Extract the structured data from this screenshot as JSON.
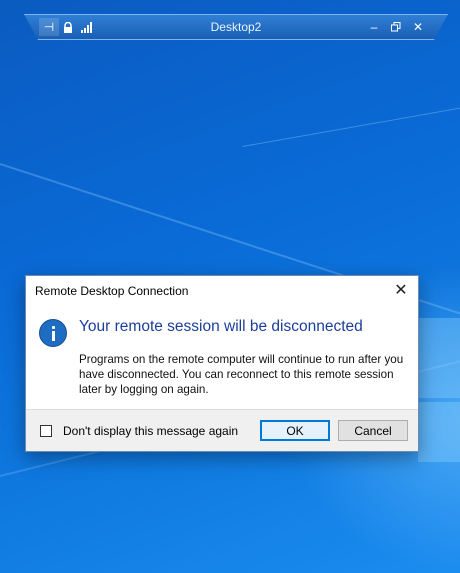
{
  "connection_bar": {
    "title": "Desktop2",
    "icons": {
      "pin": "pin-icon",
      "lock": "lock-icon",
      "signal": "signal-strength-icon",
      "minimize": "minimize-icon",
      "restore": "restore-icon",
      "close": "close-icon"
    },
    "glyphs": {
      "pin": "⊣",
      "lock": "🔒",
      "signal": "▂▄▆",
      "minimize": "–",
      "restore": "⧉",
      "close": "✕"
    }
  },
  "dialog": {
    "title": "Remote Desktop Connection",
    "close_glyph": "✕",
    "heading": "Your remote session will be disconnected",
    "message": "Programs on the remote computer will continue to run after you have disconnected. You can reconnect to this remote session later by logging on again.",
    "checkbox_label": "Don't display this message again",
    "checkbox_checked": false,
    "ok_label": "OK",
    "cancel_label": "Cancel"
  },
  "colors": {
    "desktop_blue": "#0a63c9",
    "heading_blue": "#1c3e9a",
    "info_icon": "#1f6dc3",
    "ok_focus": "#0078d7"
  }
}
